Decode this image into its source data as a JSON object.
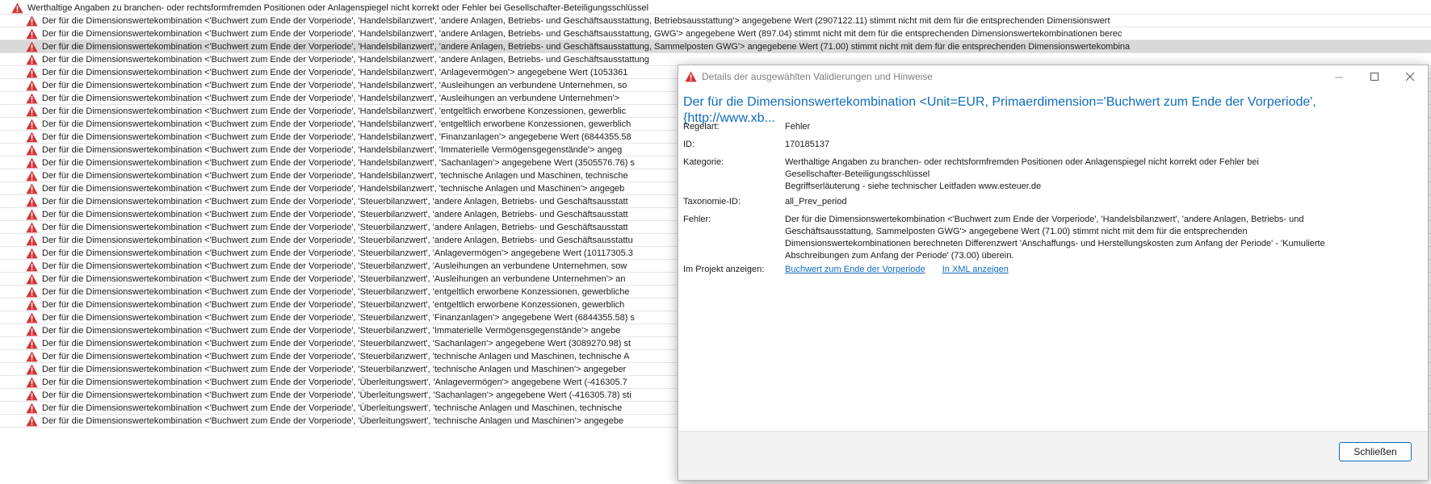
{
  "list": {
    "parent": "Werthaltige Angaben zu branchen- oder rechtsformfremden Positionen oder Anlagenspiegel nicht korrekt oder Fehler bei Gesellschafter-Beteiligungsschlüssel",
    "rows": [
      "Der für die Dimensionswertekombination <'Buchwert zum Ende der Vorperiode', 'Handelsbilanzwert', 'andere Anlagen, Betriebs- und Geschäftsausstattung, Betriebsausstattung'> angegebene Wert (2907122.11) stimmt nicht mit dem für die entsprechenden Dimensionswert",
      "Der für die Dimensionswertekombination <'Buchwert zum Ende der Vorperiode', 'Handelsbilanzwert', 'andere Anlagen, Betriebs- und Geschäftsausstattung, GWG'> angegebene Wert (897.04) stimmt nicht mit dem für die entsprechenden Dimensionswertekombinationen berec",
      "Der für die Dimensionswertekombination <'Buchwert zum Ende der Vorperiode', 'Handelsbilanzwert', 'andere Anlagen, Betriebs- und Geschäftsausstattung, Sammelposten GWG'> angegebene Wert (71.00) stimmt nicht mit dem für die entsprechenden Dimensionswertekombina",
      "Der für die Dimensionswertekombination <'Buchwert zum Ende der Vorperiode', 'Handelsbilanzwert', 'andere Anlagen, Betriebs- und Geschäftsausstattung",
      "Der für die Dimensionswertekombination <'Buchwert zum Ende der Vorperiode', 'Handelsbilanzwert', 'Anlagevermögen'> angegebene Wert (1053361",
      "Der für die Dimensionswertekombination <'Buchwert zum Ende der Vorperiode', 'Handelsbilanzwert', 'Ausleihungen an verbundene Unternehmen, so",
      "Der für die Dimensionswertekombination <'Buchwert zum Ende der Vorperiode', 'Handelsbilanzwert', 'Ausleihungen an verbundene Unternehmen'>",
      "Der für die Dimensionswertekombination <'Buchwert zum Ende der Vorperiode', 'Handelsbilanzwert', 'entgeltlich erworbene Konzessionen, gewerblic",
      "Der für die Dimensionswertekombination <'Buchwert zum Ende der Vorperiode', 'Handelsbilanzwert', 'entgeltlich erworbene Konzessionen, gewerblich",
      "Der für die Dimensionswertekombination <'Buchwert zum Ende der Vorperiode', 'Handelsbilanzwert', 'Finanzanlagen'> angegebene Wert (6844355.58",
      "Der für die Dimensionswertekombination <'Buchwert zum Ende der Vorperiode', 'Handelsbilanzwert', 'Immaterielle Vermögensgegenstände'> angeg",
      "Der für die Dimensionswertekombination <'Buchwert zum Ende der Vorperiode', 'Handelsbilanzwert', 'Sachanlagen'> angegebene Wert (3505576.76) s",
      "Der für die Dimensionswertekombination <'Buchwert zum Ende der Vorperiode', 'Handelsbilanzwert', 'technische Anlagen und Maschinen, technische",
      "Der für die Dimensionswertekombination <'Buchwert zum Ende der Vorperiode', 'Handelsbilanzwert', 'technische Anlagen und Maschinen'> angegeb",
      "Der für die Dimensionswertekombination <'Buchwert zum Ende der Vorperiode', 'Steuerbilanzwert', 'andere Anlagen, Betriebs- und Geschäftsausstatt",
      "Der für die Dimensionswertekombination <'Buchwert zum Ende der Vorperiode', 'Steuerbilanzwert', 'andere Anlagen, Betriebs- und Geschäftsausstatt",
      "Der für die Dimensionswertekombination <'Buchwert zum Ende der Vorperiode', 'Steuerbilanzwert', 'andere Anlagen, Betriebs- und Geschäftsausstatt",
      "Der für die Dimensionswertekombination <'Buchwert zum Ende der Vorperiode', 'Steuerbilanzwert', 'andere Anlagen, Betriebs- und Geschäftsausstattu",
      "Der für die Dimensionswertekombination <'Buchwert zum Ende der Vorperiode', 'Steuerbilanzwert', 'Anlagevermögen'> angegebene Wert (10117305.3",
      "Der für die Dimensionswertekombination <'Buchwert zum Ende der Vorperiode', 'Steuerbilanzwert', 'Ausleihungen an verbundene Unternehmen, sow",
      "Der für die Dimensionswertekombination <'Buchwert zum Ende der Vorperiode', 'Steuerbilanzwert', 'Ausleihungen an verbundene Unternehmen'> an",
      "Der für die Dimensionswertekombination <'Buchwert zum Ende der Vorperiode', 'Steuerbilanzwert', 'entgeltlich erworbene Konzessionen, gewerbliche",
      "Der für die Dimensionswertekombination <'Buchwert zum Ende der Vorperiode', 'Steuerbilanzwert', 'entgeltlich erworbene Konzessionen, gewerblich",
      "Der für die Dimensionswertekombination <'Buchwert zum Ende der Vorperiode', 'Steuerbilanzwert', 'Finanzanlagen'> angegebene Wert (6844355.58) s",
      "Der für die Dimensionswertekombination <'Buchwert zum Ende der Vorperiode', 'Steuerbilanzwert', 'Immaterielle Vermögensgegenstände'> angebe",
      "Der für die Dimensionswertekombination <'Buchwert zum Ende der Vorperiode', 'Steuerbilanzwert', 'Sachanlagen'> angegebene Wert (3089270.98) st",
      "Der für die Dimensionswertekombination <'Buchwert zum Ende der Vorperiode', 'Steuerbilanzwert', 'technische Anlagen und Maschinen, technische A",
      "Der für die Dimensionswertekombination <'Buchwert zum Ende der Vorperiode', 'Steuerbilanzwert', 'technische Anlagen und Maschinen'> angegeber",
      "Der für die Dimensionswertekombination <'Buchwert zum Ende der Vorperiode', 'Überleitungswert', 'Anlagevermögen'> angegebene Wert (-416305.7",
      "Der für die Dimensionswertekombination <'Buchwert zum Ende der Vorperiode', 'Überleitungswert', 'Sachanlagen'> angegebene Wert (-416305.78) sti",
      "Der für die Dimensionswertekombination <'Buchwert zum Ende der Vorperiode', 'Überleitungswert', 'technische Anlagen und Maschinen, technische",
      "Der für die Dimensionswertekombination <'Buchwert zum Ende der Vorperiode', 'Überleitungswert', 'technische Anlagen und Maschinen'> angegebe"
    ],
    "selected_index": 2
  },
  "dialog": {
    "title": "Details der ausgewählten Validierungen und Hinweise",
    "heading_line1": "Der für die Dimensionswertekombination <Unit=EUR, Primaerdimension='Buchwert zum Ende der Vorperiode',",
    "heading_line2": "{http://www.xb...",
    "labels": {
      "regelart": "Regelart:",
      "id": "ID:",
      "kategorie": "Kategorie:",
      "taxonomie": "Taxonomie-ID:",
      "fehler": "Fehler:",
      "projekt": "Im Projekt anzeigen:"
    },
    "values": {
      "regelart": "Fehler",
      "id": "170185137",
      "kategorie_line1": "Werthaltige Angaben zu branchen- oder rechtsformfremden Positionen oder Anlagenspiegel nicht korrekt oder Fehler bei",
      "kategorie_line2": "Gesellschafter-Beteiligungsschlüssel",
      "kategorie_line3": "Begriffserläuterung - siehe technischer Leitfaden www.esteuer.de",
      "taxonomie": "all_Prev_period",
      "fehler_line1": "Der für die Dimensionswertekombination <'Buchwert zum Ende der Vorperiode', 'Handelsbilanzwert', 'andere Anlagen, Betriebs- und",
      "fehler_line2": "Geschäftsausstattung, Sammelposten GWG'> angegebene Wert (71.00) stimmt nicht mit dem für die entsprechenden",
      "fehler_line3": "Dimensionswertekombinationen berechneten Differenzwert 'Anschaffungs- und Herstellungskosten zum Anfang der Periode' - 'Kumulierte",
      "fehler_line4": "Abschreibungen zum Anfang der Periode' (73.00) überein."
    },
    "links": {
      "buchwert": "Buchwert zum Ende der Vorperiode",
      "xml": "In XML anzeigen"
    },
    "close_label": "Schließen"
  },
  "colors": {
    "accent": "#0f6cbd",
    "error_red": "#d13438",
    "selected_row": "#d9d9d9"
  },
  "icons": {
    "row_icon": "error-warning-icon",
    "title_icon": "error-warning-icon"
  }
}
